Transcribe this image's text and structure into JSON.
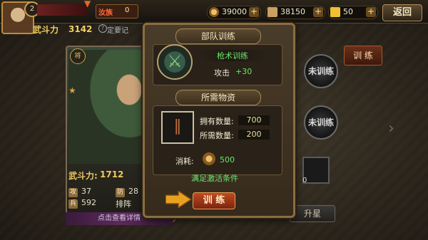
{
  "header": {
    "level": "2",
    "clan_label": "汝族",
    "clan_value": "0",
    "resources": {
      "copper": "39000",
      "grain": "38150",
      "gold": "50",
      "plus": "+"
    },
    "back_label": "返回"
  },
  "battle": {
    "label": "武斗力",
    "value": "3142",
    "hint": "定要记"
  },
  "card": {
    "bp_label": "武斗力:",
    "bp_value": "1712",
    "stats": {
      "atk_key": "攻",
      "atk": "37",
      "def_key": "防",
      "def": "28",
      "hp_key": "兵",
      "hp": "592",
      "rank_key": "排",
      "rank": "排阵"
    },
    "detail": "点击查看详情"
  },
  "right": {
    "train_tab": "训 练",
    "untrained": "未训练",
    "item_count": "0",
    "upgrade": "升星"
  },
  "modal": {
    "title": "部队训练",
    "skill_name": "枪术训练",
    "attack_label": "攻击",
    "attack_value": "+30",
    "materials_title": "所需物资",
    "own_label": "拥有数量:",
    "own_value": "700",
    "need_label": "所需数量:",
    "need_value": "200",
    "cost_label": "消耗:",
    "cost_value": "500",
    "condition": "满足激活条件",
    "train_button": "训 练"
  },
  "icons": {
    "skill": "trident-icon",
    "item": "scroll-bundle-icon",
    "coin": "copper-coin-icon"
  }
}
